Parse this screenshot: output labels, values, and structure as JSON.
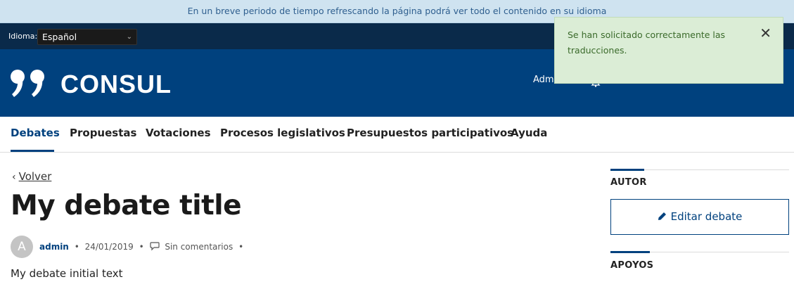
{
  "notice": {
    "text": "En un breve periodo de tiempo refrescando la página podrá ver todo el contenido en su idioma"
  },
  "locale": {
    "label": "Idioma:",
    "selected": "Español"
  },
  "header": {
    "logo_text": "CONSUL",
    "admin_link": "Admi"
  },
  "toast": {
    "message": "Se han solicitado correctamente las traducciones.",
    "close_glyph": "✕"
  },
  "nav": {
    "items": [
      {
        "label": "Debates",
        "active": true
      },
      {
        "label": "Propuestas",
        "active": false
      },
      {
        "label": "Votaciones",
        "active": false
      },
      {
        "label": "Procesos legislativos",
        "active": false
      },
      {
        "label": "Presupuestos participativos",
        "active": false
      },
      {
        "label": "Ayuda",
        "active": false
      }
    ]
  },
  "debate": {
    "back_label": "Volver",
    "title": "My debate title",
    "avatar_initial": "A",
    "author": "admin",
    "date": "24/01/2019",
    "comments": "Sin comentarios",
    "body": "My debate initial text"
  },
  "sidebar": {
    "author_heading": "AUTOR",
    "edit_button": "Editar debate",
    "supports_heading": "APOYOS"
  },
  "colors": {
    "brand": "#00417e",
    "toast_bg": "#dbedd6",
    "notice_bg": "#cfe3f0"
  },
  "icons": [
    "logo-quote-icon",
    "chevron-down-icon",
    "bell-icon",
    "close-icon",
    "chevron-left-icon",
    "comment-icon",
    "pencil-icon"
  ]
}
